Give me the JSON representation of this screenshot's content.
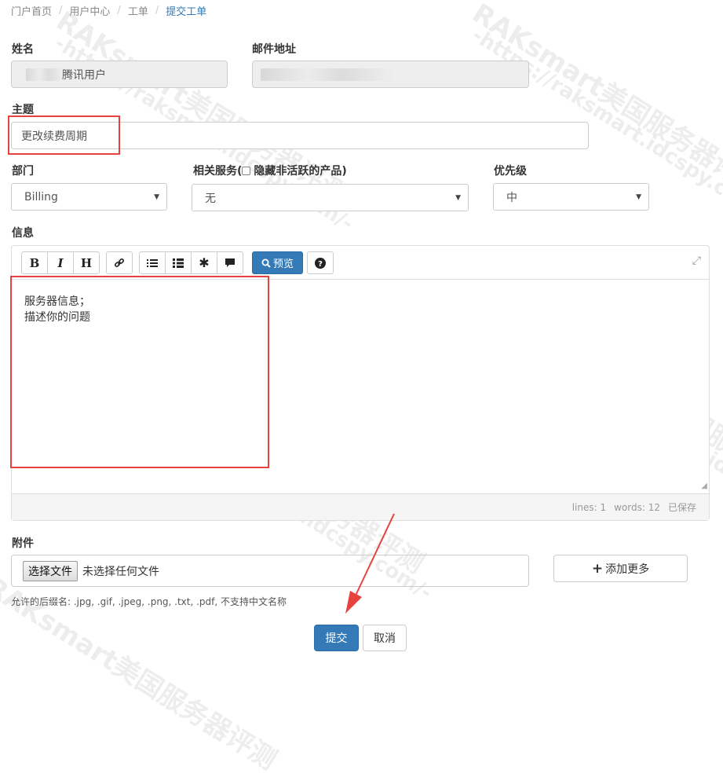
{
  "breadcrumb": [
    "门户首页",
    "用户中心",
    "工单",
    "提交工单"
  ],
  "form": {
    "name_label": "姓名",
    "name_value": "腾讯用户",
    "email_label": "邮件地址",
    "subject_label": "主题",
    "subject_value": "更改续费周期",
    "department_label": "部门",
    "department_value": "Billing",
    "service_label_prefix": "相关服务(",
    "service_label_suffix": "隐藏非活跃的产品)",
    "service_value": "无",
    "priority_label": "优先级",
    "priority_value": "中",
    "message_label": "信息"
  },
  "editor": {
    "toolbar": {
      "bold": "B",
      "italic": "I",
      "heading": "H",
      "preview": "预览"
    },
    "content": "服务器信息；\n描述你的问题",
    "status": {
      "lines": "lines: 1",
      "words": "words: 12",
      "saved": "已保存"
    }
  },
  "attachments": {
    "label": "附件",
    "choose_button": "选择文件",
    "no_file_text": "未选择任何文件",
    "add_more": "添加更多",
    "hint": "允许的后缀名: .jpg, .gif, .jpeg, .png, .txt, .pdf, 不支持中文名称"
  },
  "actions": {
    "submit": "提交",
    "cancel": "取消"
  },
  "watermark": {
    "brand": "RAKsmart美国服务器评测",
    "url": "-https://raksmart.idcspy.com/-"
  },
  "colors": {
    "primary": "#337ab7",
    "annotation_red": "#e8423e"
  }
}
